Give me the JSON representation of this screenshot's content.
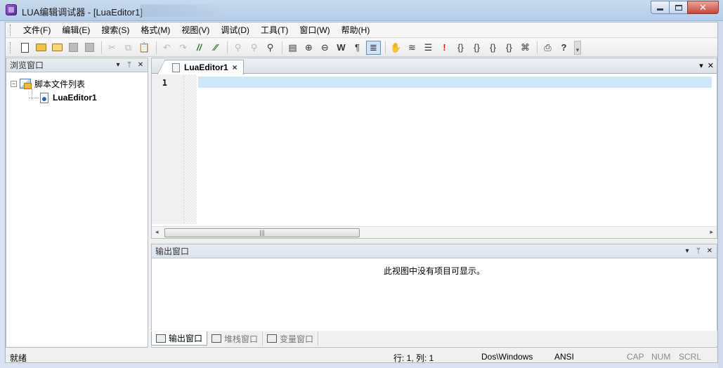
{
  "window": {
    "title": "LUA编辑调试器 - [LuaEditor1]",
    "close_glyph": "✕"
  },
  "menu": [
    "文件(F)",
    "编辑(E)",
    "搜索(S)",
    "格式(M)",
    "视图(V)",
    "调试(D)",
    "工具(T)",
    "窗口(W)",
    "帮助(H)"
  ],
  "toolbar": {
    "icons": [
      "new-file-icon",
      "open-file-icon",
      "open-folder-icon",
      "save-icon",
      "save-all-icon",
      "sep",
      "cut-icon",
      "copy-icon",
      "paste-icon",
      "sep",
      "undo-icon",
      "redo-icon",
      "comment-icon",
      "uncomment-icon",
      "sep",
      "find-icon",
      "find-next-icon",
      "replace-icon",
      "sep",
      "bookmark-icon",
      "zoom-in-icon",
      "zoom-out-icon",
      "word-wrap-icon",
      "pilcrow-icon",
      "line-numbers-icon",
      "sep",
      "hand-icon",
      "layers-icon",
      "list-icon",
      "breakpoint-icon",
      "step-into-icon",
      "step-over-icon",
      "step-out-icon",
      "run-to-cursor-icon",
      "watch-icon",
      "sep",
      "print-icon",
      "help-icon"
    ]
  },
  "browse_panel": {
    "title": "浏览窗口",
    "tree": {
      "root_label": "脚本文件列表",
      "expander": "−",
      "child_label": "LuaEditor1"
    }
  },
  "editor": {
    "tab_label": "LuaEditor1",
    "tab_close": "×",
    "line_number": "1",
    "scroll_thumb_grip": "|||"
  },
  "output_panel": {
    "title": "输出窗口",
    "message": "此视图中没有项目可显示。",
    "tabs": [
      "输出窗口",
      "堆栈窗口",
      "变量窗口"
    ]
  },
  "panel_buttons": {
    "dropdown": "▾",
    "pin": "ᛘ",
    "close": "✕"
  },
  "statusbar": {
    "ready": "就绪",
    "position": "行: 1, 列: 1",
    "line_ending": "Dos\\Windows",
    "encoding": "ANSI",
    "caps": "CAP",
    "num": "NUM",
    "scroll": "SCRL"
  },
  "colors": {
    "title_bar": "#c9d9ee",
    "current_line": "#cde8f7",
    "close_button": "#c8463a"
  }
}
